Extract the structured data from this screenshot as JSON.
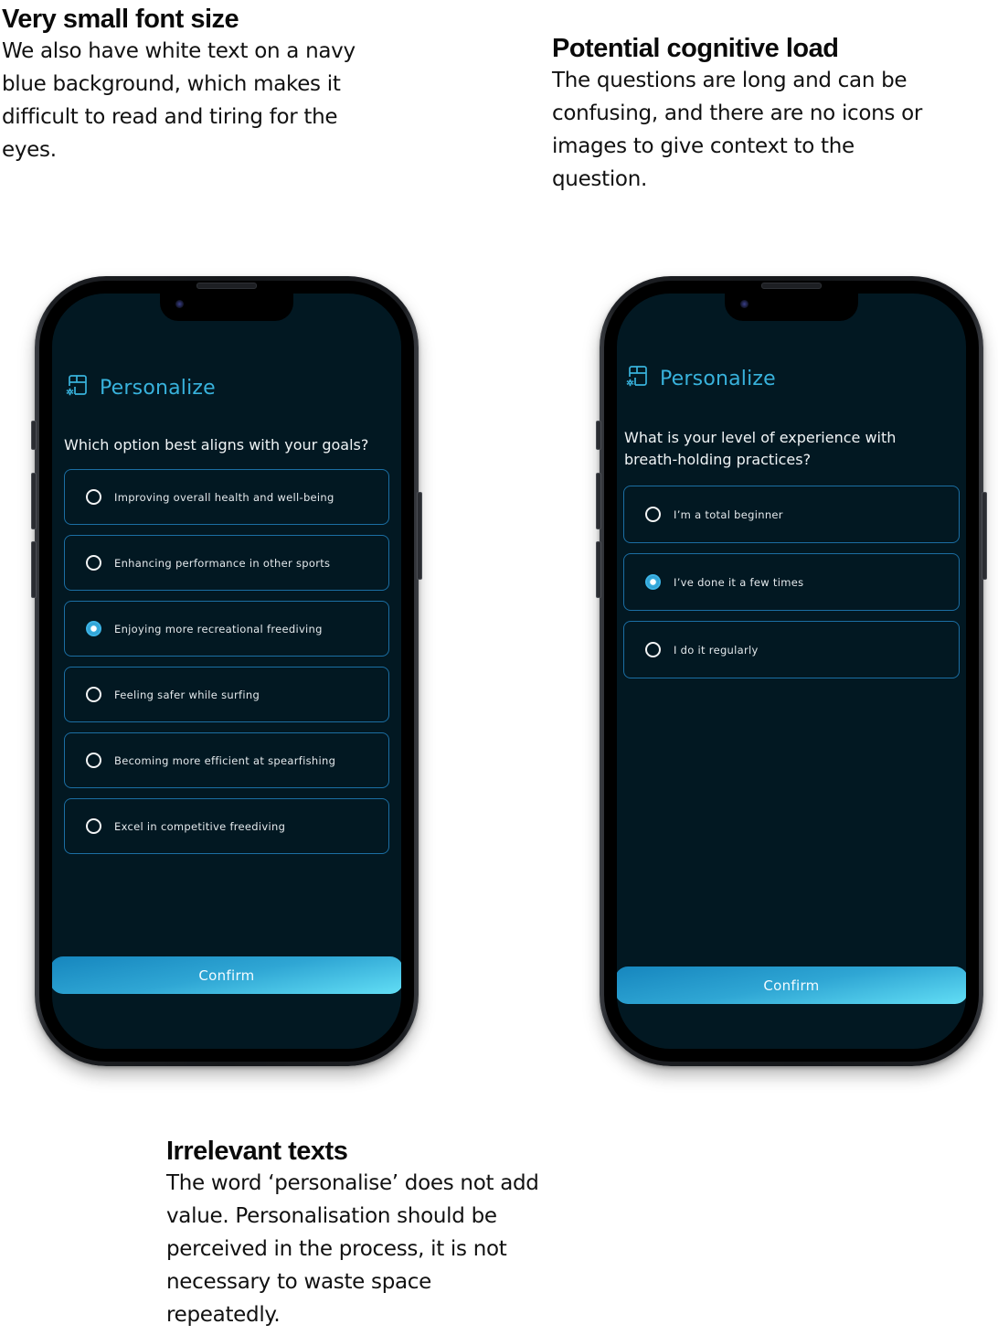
{
  "annotations": [
    {
      "title": "Very small font size",
      "body": "We also have white text on a navy blue background, which makes it difficult to read and tiring for the eyes."
    },
    {
      "title": "Potential cognitive load",
      "body": "The questions are long and can be confusing, and there are no icons or images to give context to the question."
    },
    {
      "title": "Irrelevant texts",
      "body": "The word ‘personalise’ does not add value. Personalisation should be perceived in the process, it is not necessary to waste space repeatedly."
    }
  ],
  "screens": [
    {
      "header": {
        "icon": "personalize-layout-gear-icon",
        "title": "Personalize"
      },
      "question": "Which option best aligns with your goals?",
      "options": [
        {
          "label": "Improving overall health and well-being",
          "selected": false
        },
        {
          "label": "Enhancing performance in other sports",
          "selected": false
        },
        {
          "label": "Enjoying more recreational freediving",
          "selected": true
        },
        {
          "label": "Feeling safer while surfing",
          "selected": false
        },
        {
          "label": "Becoming more efficient at spearfishing",
          "selected": false
        },
        {
          "label": "Excel in competitive freediving",
          "selected": false
        }
      ],
      "confirm_label": "Confirm"
    },
    {
      "header": {
        "icon": "personalize-layout-gear-icon",
        "title": "Personalize"
      },
      "question": "What is your level of experience with\n breath-holding practices?",
      "options": [
        {
          "label": "I’m a total beginner",
          "selected": false
        },
        {
          "label": "I’ve done it a few times",
          "selected": true
        },
        {
          "label": "I do it regularly",
          "selected": false
        }
      ],
      "confirm_label": "Confirm"
    }
  ],
  "colors": {
    "screen_background": "#021822",
    "accent": "#38b2dc",
    "option_border": "#1b6ea3",
    "button_gradient_start": "#1686be",
    "button_gradient_end": "#62def5"
  }
}
